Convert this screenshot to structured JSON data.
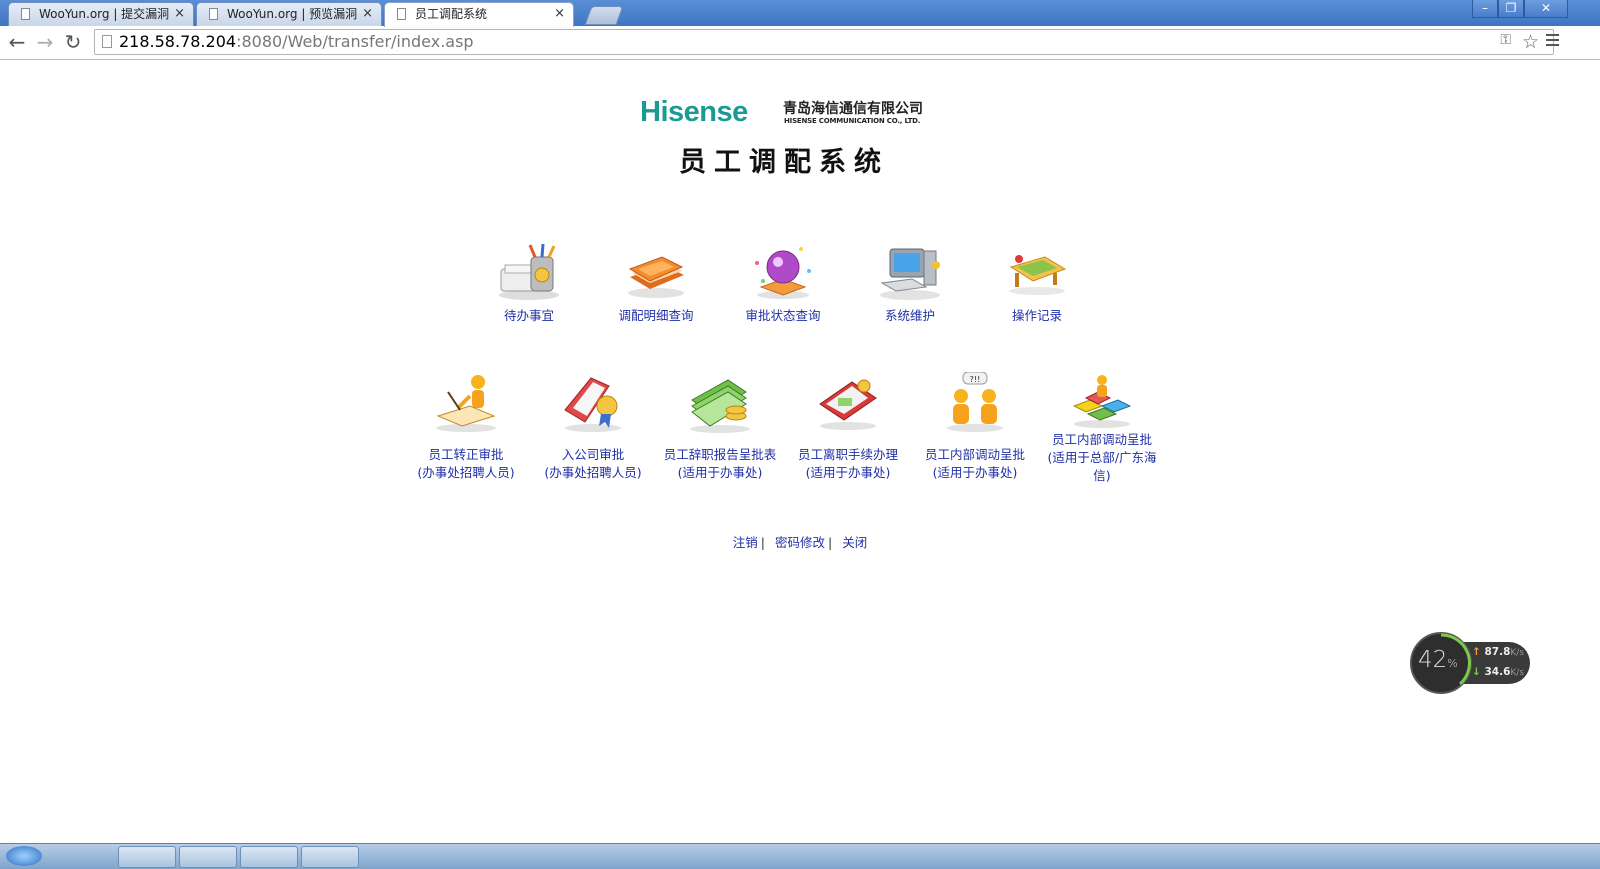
{
  "browser": {
    "tabs": [
      {
        "title": "WooYun.org | 提交漏洞",
        "active": false
      },
      {
        "title": "WooYun.org | 预览漏洞",
        "active": false
      },
      {
        "title": "员工调配系统",
        "active": true
      }
    ],
    "close_glyph": "×",
    "url_host": "218.58.78.204",
    "url_rest": ":8080/Web/transfer/index.asp",
    "window_controls": [
      "minimize-icon",
      "restore-icon",
      "close-icon"
    ]
  },
  "page": {
    "brand": "Hisense",
    "company_cn": "青岛海信通信有限公司",
    "company_en": "HISENSE COMMUNICATION CO., LTD.",
    "system_title": "员工调配系统",
    "brand_color": "#1a9a93",
    "link_color": "#1f2fa8",
    "row1": [
      {
        "label": "待办事宜",
        "icon": "pending-tasks-icon"
      },
      {
        "label": "调配明细查询",
        "icon": "books-icon"
      },
      {
        "label": "审批状态查询",
        "icon": "crystal-ball-icon"
      },
      {
        "label": "系统维护",
        "icon": "computer-icon"
      },
      {
        "label": "操作记录",
        "icon": "records-icon"
      }
    ],
    "row2": [
      {
        "label1": "员工转正审批",
        "label2": "(办事处招聘人员)",
        "icon": "signing-person-icon"
      },
      {
        "label1": "入公司审批",
        "label2": "(办事处招聘人员)",
        "icon": "certificate-icon"
      },
      {
        "label1": "员工辞职报告呈批表",
        "label2": "(适用于办事处)",
        "icon": "money-icon"
      },
      {
        "label1": "员工离职手续办理",
        "label2": "(适用于办事处)",
        "icon": "wallet-icon"
      },
      {
        "label1": "员工内部调动呈批",
        "label2": "(适用于办事处)",
        "icon": "two-people-icon"
      },
      {
        "label1": "员工内部调动呈批",
        "label2": "(适用于总部/广东海",
        "label3": "信)",
        "icon": "team-blocks-icon"
      }
    ],
    "footer": {
      "logout": "注销",
      "change_password": "密码修改",
      "close": "关闭",
      "sep": "|"
    }
  },
  "speed_widget": {
    "percent": "42",
    "percent_sign": "%",
    "upload": "87.8",
    "download": "34.6",
    "unit": "K/s"
  }
}
